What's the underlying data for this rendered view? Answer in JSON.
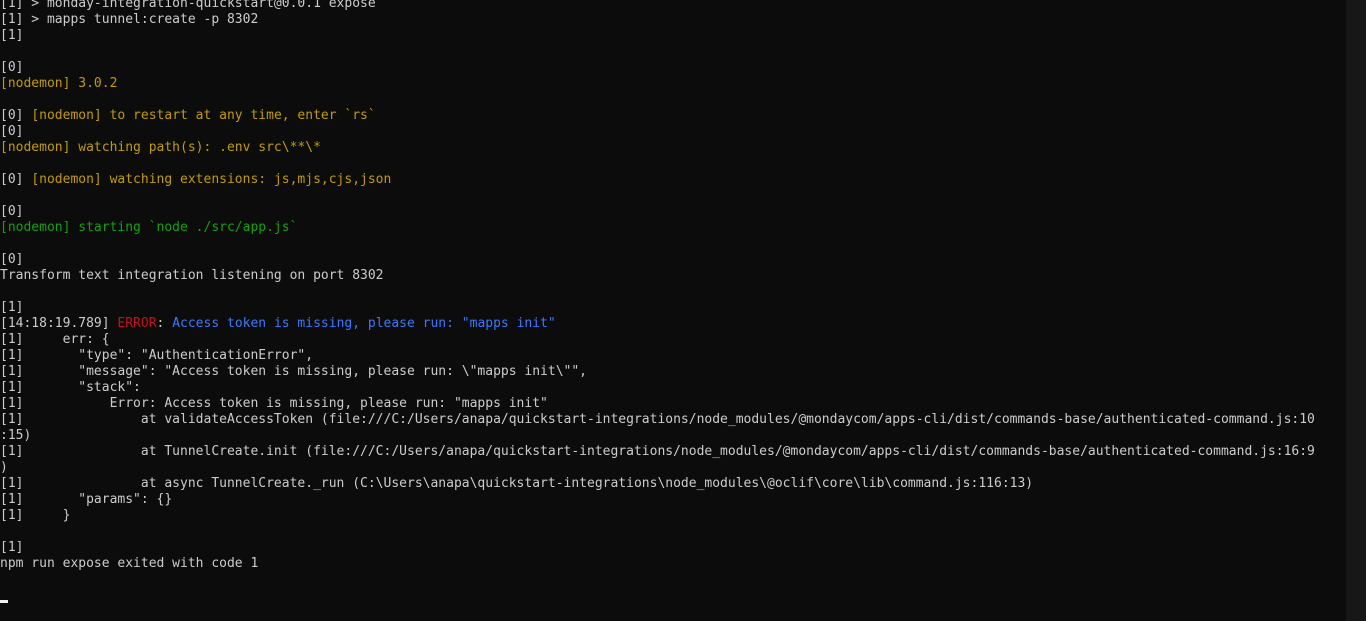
{
  "terminal": {
    "lines": [
      [
        {
          "t": "[1] > monday-integration-quickstart@0.0.1 expose",
          "c": "default"
        }
      ],
      [
        {
          "t": "[1] > mapps tunnel:create -p 8302",
          "c": "default"
        }
      ],
      [
        {
          "t": "[1]",
          "c": "default"
        }
      ],
      [],
      [
        {
          "t": "[0]",
          "c": "default"
        }
      ],
      [
        {
          "t": "[nodemon] 3.0.2",
          "c": "yellow"
        }
      ],
      [],
      [
        {
          "t": "[0] ",
          "c": "default"
        },
        {
          "t": "[nodemon] to restart at any time, enter `rs`",
          "c": "yellow"
        }
      ],
      [
        {
          "t": "[0]",
          "c": "default"
        }
      ],
      [
        {
          "t": "[nodemon] watching path(s): .env src\\**\\*",
          "c": "yellow"
        }
      ],
      [],
      [
        {
          "t": "[0] ",
          "c": "default"
        },
        {
          "t": "[nodemon] watching extensions: js,mjs,cjs,json",
          "c": "yellow"
        }
      ],
      [],
      [
        {
          "t": "[0]",
          "c": "default"
        }
      ],
      [
        {
          "t": "[nodemon] starting `node ./src/app.js`",
          "c": "green"
        }
      ],
      [],
      [
        {
          "t": "[0]",
          "c": "default"
        }
      ],
      [
        {
          "t": "Transform text integration listening on port 8302",
          "c": "default"
        }
      ],
      [],
      [
        {
          "t": "[1]",
          "c": "default"
        }
      ],
      [
        {
          "t": "[14:18:19.789] ",
          "c": "default"
        },
        {
          "t": "ERROR",
          "c": "red"
        },
        {
          "t": ": ",
          "c": "default"
        },
        {
          "t": "Access token is missing, please run: \"mapps init\"",
          "c": "blue"
        }
      ],
      [
        {
          "t": "[1]     err: {",
          "c": "default"
        }
      ],
      [
        {
          "t": "[1]       \"type\": \"AuthenticationError\",",
          "c": "default"
        }
      ],
      [
        {
          "t": "[1]       \"message\": \"Access token is missing, please run: \\\"mapps init\\\"\",",
          "c": "default"
        }
      ],
      [
        {
          "t": "[1]       \"stack\":",
          "c": "default"
        }
      ],
      [
        {
          "t": "[1]           Error: Access token is missing, please run: \"mapps init\"",
          "c": "default"
        }
      ],
      [
        {
          "t": "[1]               at validateAccessToken (file:///C:/Users/anapa/quickstart-integrations/node_modules/@mondaycom/apps-cli/dist/commands-base/authenticated-command.js:10",
          "c": "default"
        }
      ],
      [
        {
          "t": ":15)",
          "c": "default"
        }
      ],
      [
        {
          "t": "[1]               at TunnelCreate.init (file:///C:/Users/anapa/quickstart-integrations/node_modules/@mondaycom/apps-cli/dist/commands-base/authenticated-command.js:16:9",
          "c": "default"
        }
      ],
      [
        {
          "t": ")",
          "c": "default"
        }
      ],
      [
        {
          "t": "[1]               at async TunnelCreate._run (C:\\Users\\anapa\\quickstart-integrations\\node_modules\\@oclif\\core\\lib\\command.js:116:13)",
          "c": "default"
        }
      ],
      [
        {
          "t": "[1]       \"params\": {}",
          "c": "default"
        }
      ],
      [
        {
          "t": "[1]     }",
          "c": "default"
        }
      ],
      [],
      [
        {
          "t": "[1]",
          "c": "default"
        }
      ],
      [
        {
          "t": "npm run expose exited with code 1",
          "c": "default"
        }
      ]
    ]
  },
  "colors": {
    "background": "#0c0c0c",
    "default": "#cccccc",
    "yellow": "#c19c00",
    "green": "#13a10e",
    "red": "#c50f1f",
    "blue": "#3b78ff",
    "scrollbar": "#171717",
    "cursor": "#f2f2f2"
  }
}
